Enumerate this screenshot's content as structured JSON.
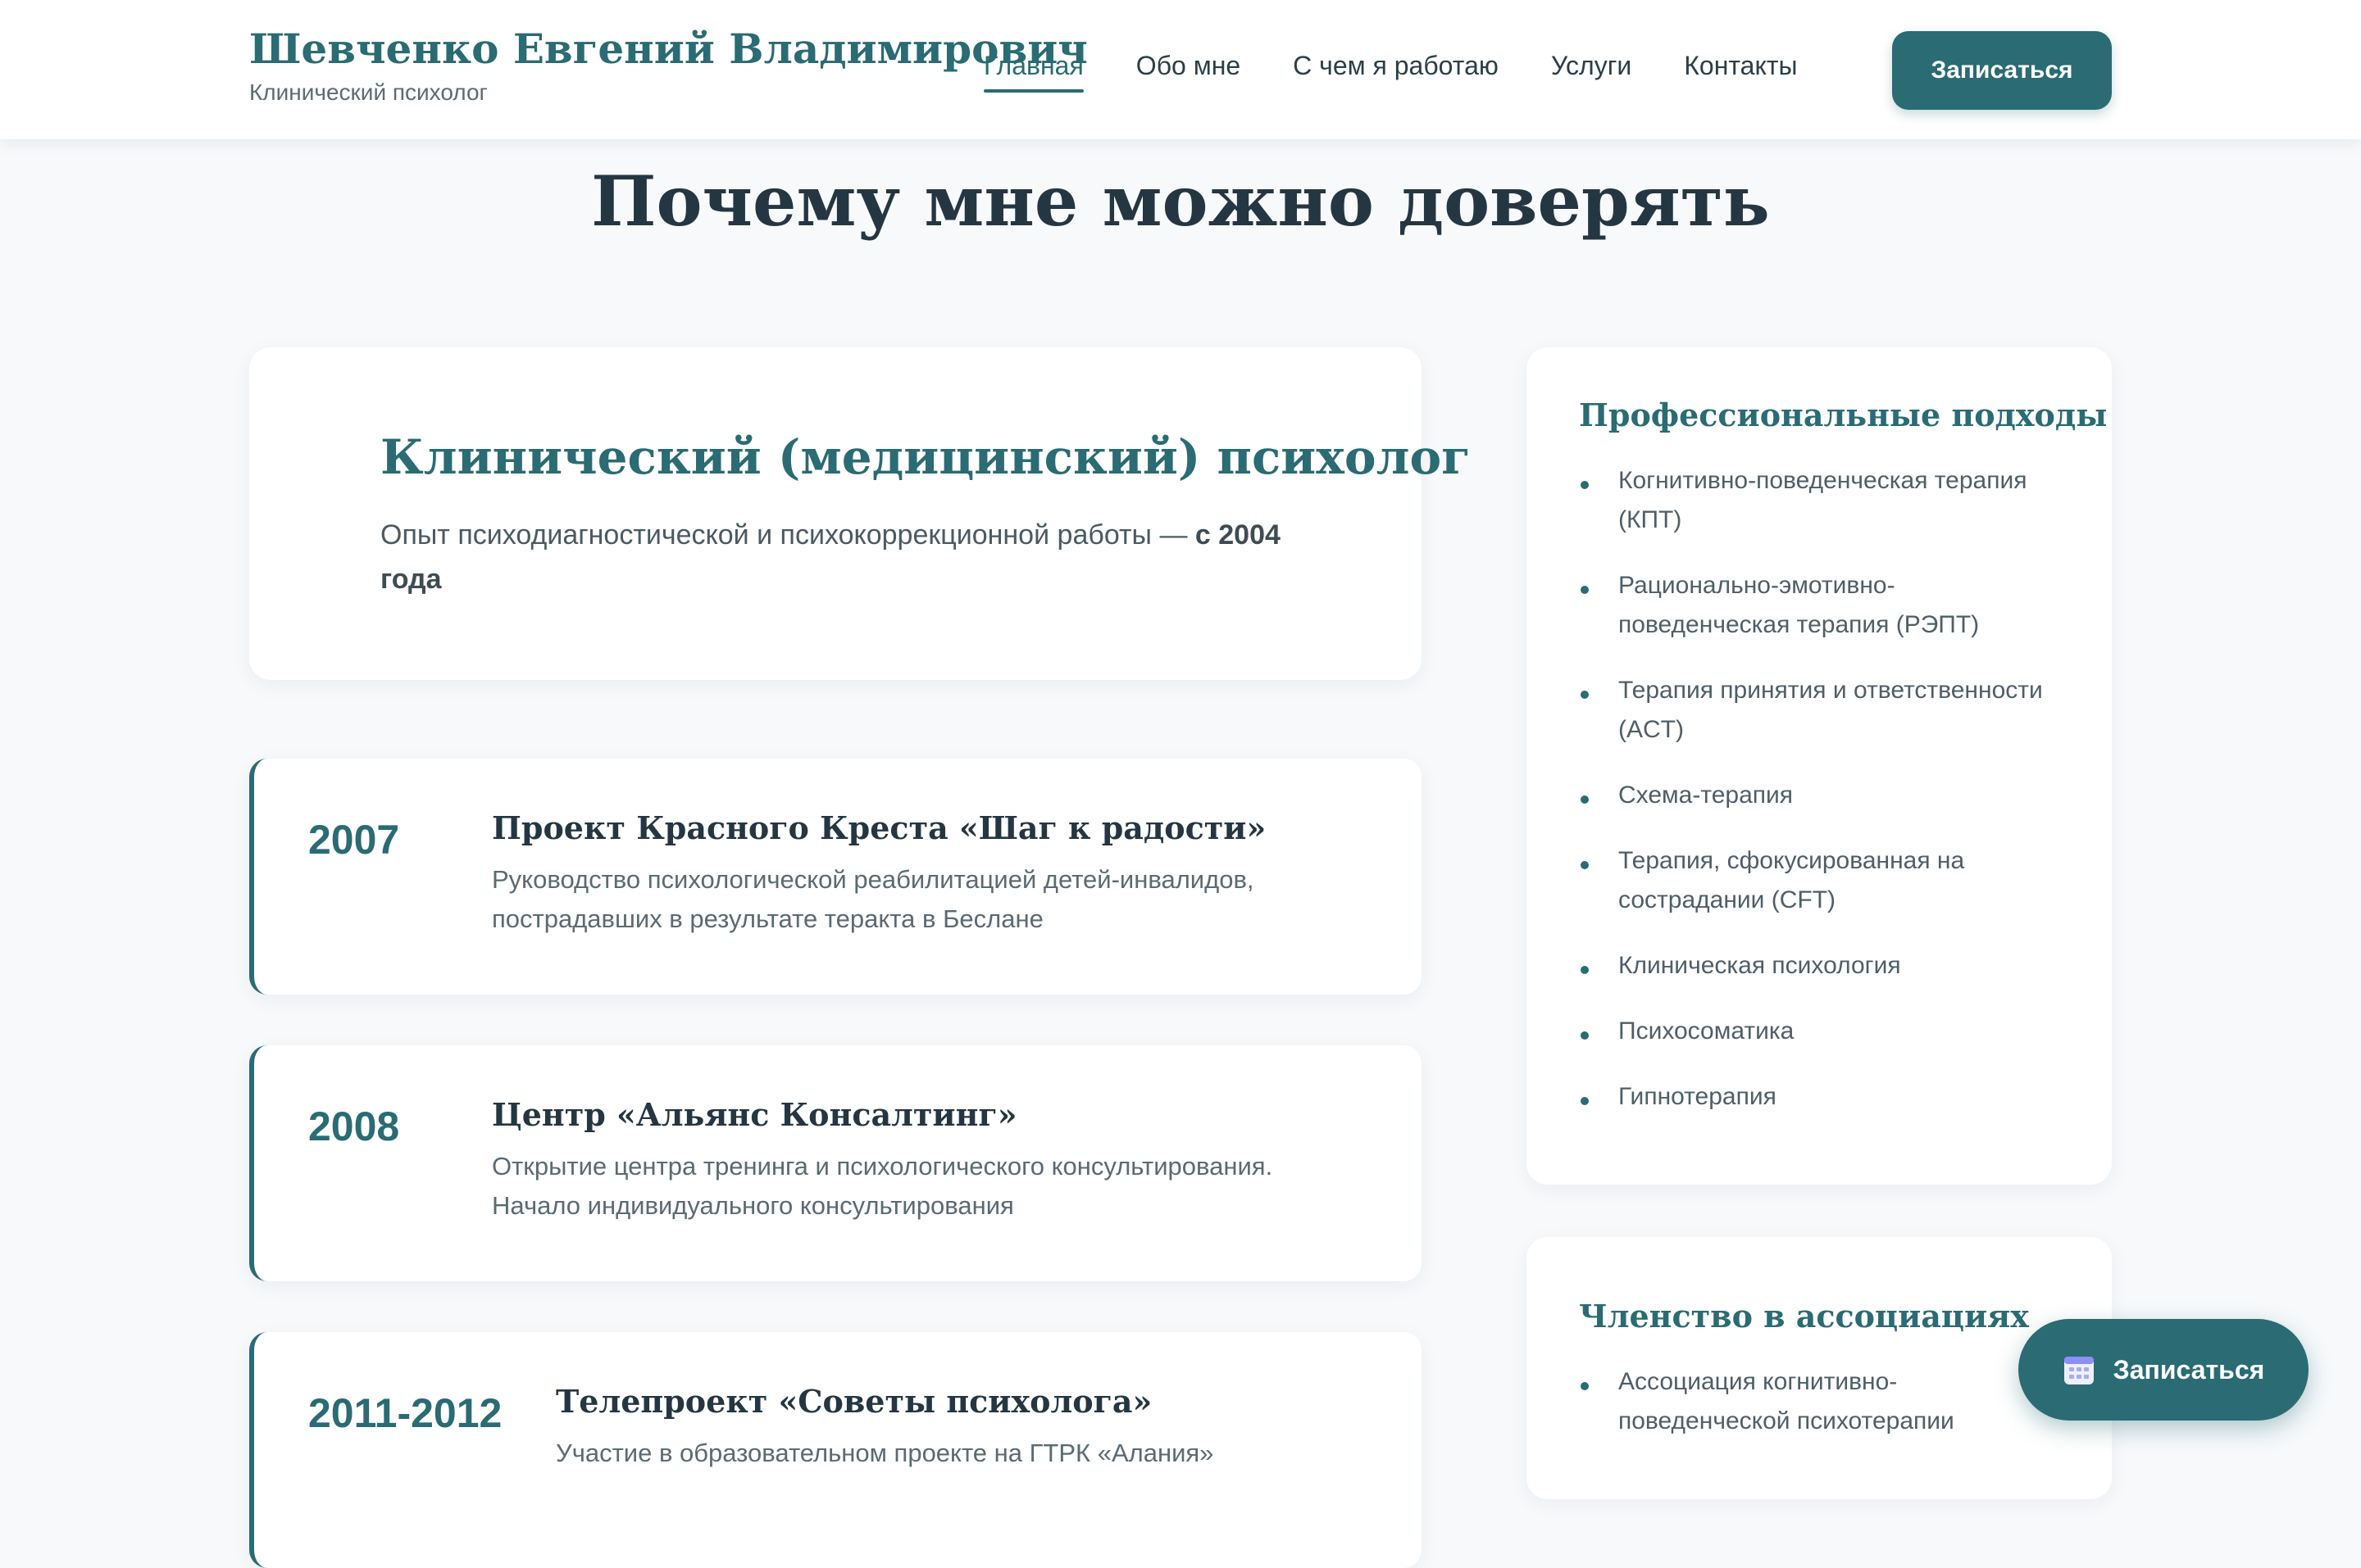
{
  "header": {
    "brand_name": "Шевченко Евгений Владимирович",
    "brand_subtitle": "Клинический психолог",
    "nav": [
      {
        "label": "Главная",
        "active": true
      },
      {
        "label": "Обо мне",
        "active": false
      },
      {
        "label": "С чем я работаю",
        "active": false
      },
      {
        "label": "Услуги",
        "active": false
      },
      {
        "label": "Контакты",
        "active": false
      }
    ],
    "cta_label": "Записаться"
  },
  "main": {
    "section_title": "Почему мне можно доверять",
    "intro": {
      "title": "Клинический (медицинский) психолог",
      "text": "Опыт психодиагностической и психокоррекционной работы — ",
      "text_bold": "с 2004 года"
    },
    "timeline": [
      {
        "year": "2007",
        "title": "Проект Красного Креста «Шаг к радости»",
        "description": "Руководство психологической реабилитацией детей-инвалидов, пострадавших в результате теракта в Беслане"
      },
      {
        "year": "2008",
        "title": "Центр «Альянс Консалтинг»",
        "description": "Открытие центра тренинга и психологического консультирования. Начало индивидуального консультирования"
      },
      {
        "year": "2011-2012",
        "title": "Телепроект «Советы психолога»",
        "description": "Участие в образовательном проекте на ГТРК «Алания»"
      }
    ]
  },
  "sidebar": {
    "approaches": {
      "title": "Профессиональные подходы",
      "items": [
        "Когнитивно-поведенческая терапия (КПТ)",
        "Рационально-эмотивно-поведенческая терапия (РЭПТ)",
        "Терапия принятия и ответственности (ACT)",
        "Схема-терапия",
        "Терапия, сфокусированная на сострадании (CFT)",
        "Клиническая психология",
        "Психосоматика",
        "Гипнотерапия"
      ]
    },
    "associations": {
      "title": "Членство в ассоциациях",
      "items": [
        "Ассоциация когнитивно-поведенческой психотерапии"
      ]
    }
  },
  "fab": {
    "label": "Записаться",
    "icon": "calendar-icon"
  },
  "colors": {
    "accent": "#2a6b74",
    "page_bg": "#f7f9fb",
    "card_bg": "#ffffff",
    "heading": "#243642"
  }
}
